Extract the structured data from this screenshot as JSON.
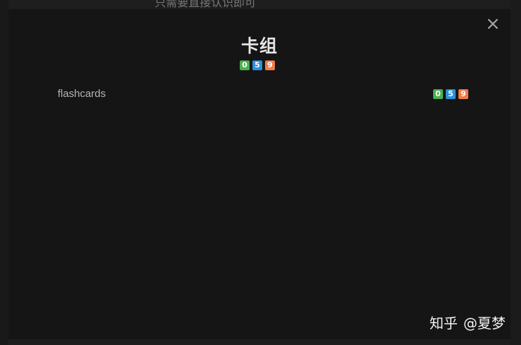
{
  "background": {
    "top_text": "只需要直接认识即可",
    "colors": {
      "page": "#1e1e1e",
      "modal": "#151515"
    }
  },
  "modal": {
    "title": "卡组",
    "close_icon": "close-icon",
    "summary_counts": {
      "new": "0",
      "learning": "5",
      "due": "9"
    },
    "decks": [
      {
        "name": "flashcards",
        "counts": {
          "new": "0",
          "learning": "5",
          "due": "9"
        }
      }
    ]
  },
  "badge_colors": {
    "new": "#4caf50",
    "learning": "#2f8fd8",
    "due": "#f07a4a"
  },
  "watermark": {
    "brand": "知乎",
    "author": "@夏梦"
  }
}
